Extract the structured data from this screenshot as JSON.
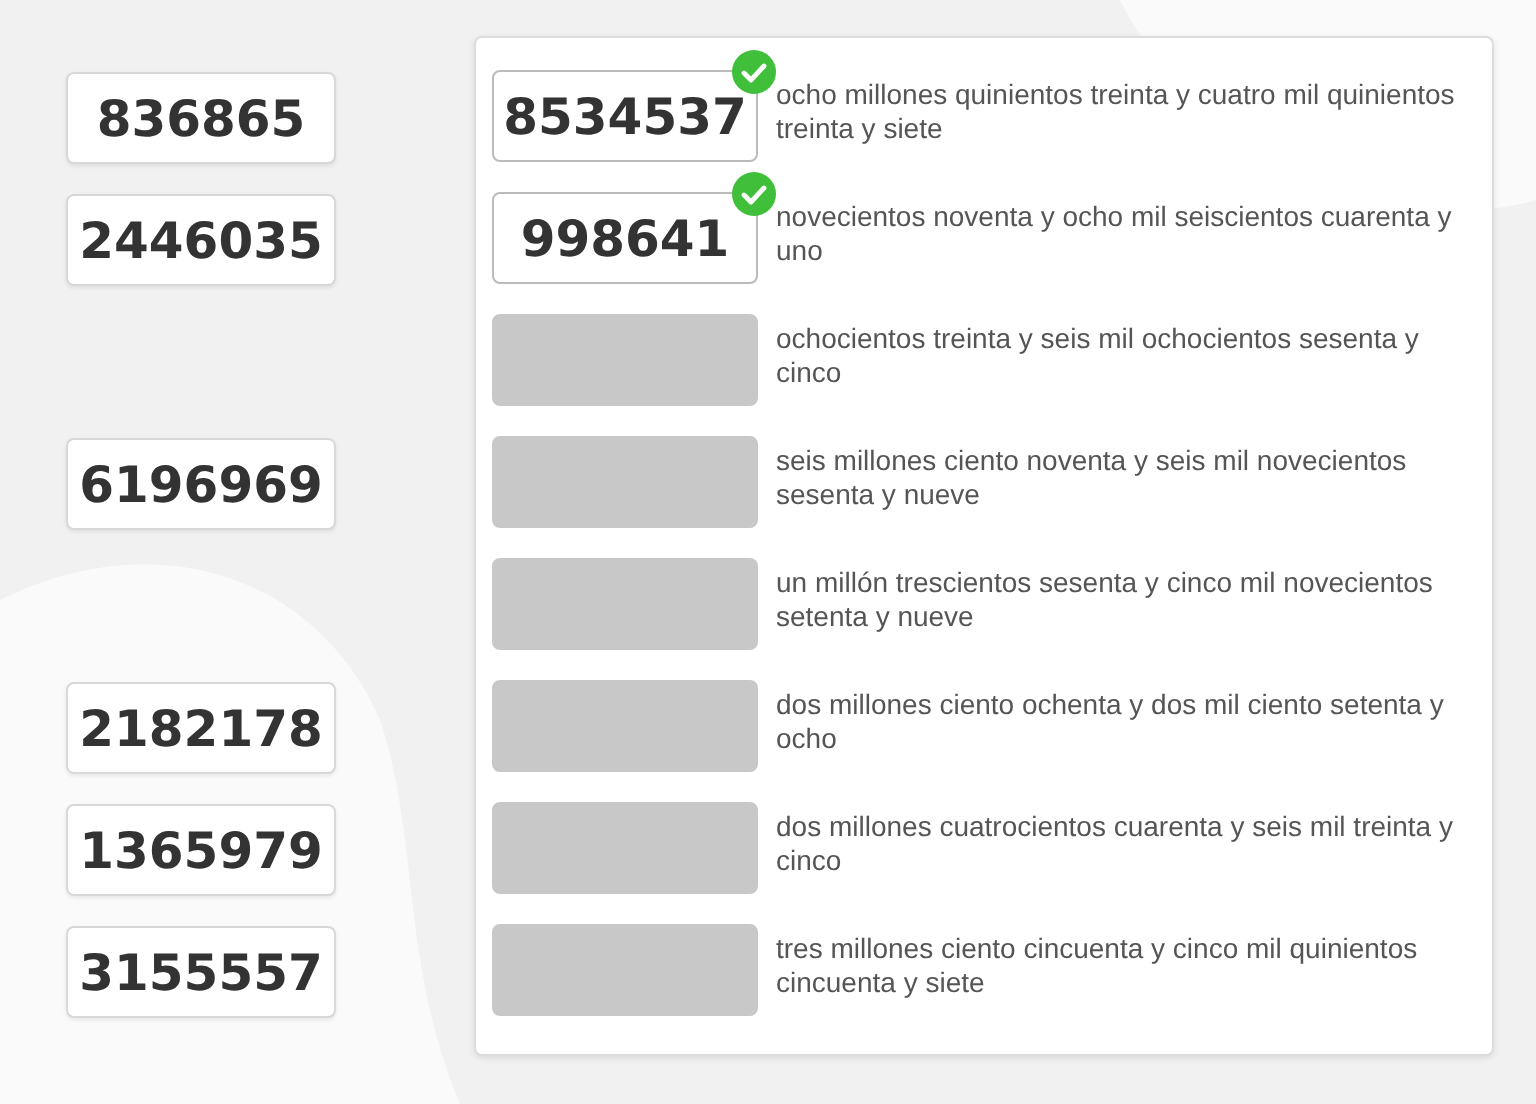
{
  "number_pool": [
    {
      "kind": "tile",
      "number": "836865"
    },
    {
      "kind": "tile",
      "number": "2446035"
    },
    {
      "kind": "empty"
    },
    {
      "kind": "tile",
      "number": "6196969"
    },
    {
      "kind": "empty"
    },
    {
      "kind": "tile",
      "number": "2182178"
    },
    {
      "kind": "tile",
      "number": "1365979"
    },
    {
      "kind": "tile",
      "number": "3155557"
    }
  ],
  "matches": [
    {
      "kind": "filled",
      "answer": "8534537",
      "correct": true,
      "description": "ocho millones quinientos treinta y cuatro mil quinientos treinta y siete"
    },
    {
      "kind": "filled",
      "answer": "998641",
      "correct": true,
      "description": "novecientos noventa y ocho mil seiscientos cuarenta y uno"
    },
    {
      "kind": "empty",
      "description": "ochocientos treinta y seis mil ochocientos sesenta y cinco"
    },
    {
      "kind": "empty",
      "description": "seis millones ciento noventa y seis mil novecientos sesenta y nueve"
    },
    {
      "kind": "empty",
      "description": "un millón trescientos sesenta y cinco mil novecientos setenta y nueve"
    },
    {
      "kind": "empty",
      "description": "dos millones ciento ochenta y dos mil ciento setenta y ocho"
    },
    {
      "kind": "empty",
      "description": "dos millones cuatrocientos cuarenta y seis mil treinta y cinco"
    },
    {
      "kind": "empty",
      "description": "tres millones ciento cincuenta y cinco mil quinientos cincuenta y siete"
    }
  ]
}
